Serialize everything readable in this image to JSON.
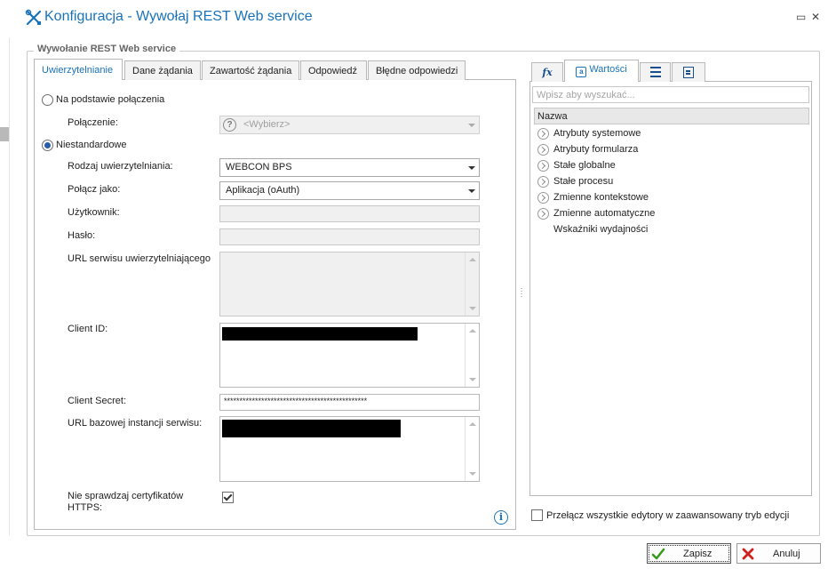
{
  "window": {
    "title": "Konfiguracja - Wywołaj REST Web service",
    "restore_glyph": "▭",
    "close_glyph": "✕",
    "icon": "tools-icon"
  },
  "group": {
    "legend": "Wywołanie REST Web service"
  },
  "tabs": [
    {
      "label": "Uwierzytelnianie",
      "active": true
    },
    {
      "label": "Dane żądania"
    },
    {
      "label": "Zawartość żądania"
    },
    {
      "label": "Odpowiedź"
    },
    {
      "label": "Błędne odpowiedzi"
    }
  ],
  "form": {
    "radio_connection": {
      "label": "Na podstawie połączenia",
      "checked": false
    },
    "connection": {
      "label": "Połączenie:",
      "value": "<Wybierz>",
      "icon": "question-icon"
    },
    "radio_custom": {
      "label": "Niestandardowe",
      "checked": true
    },
    "auth_type": {
      "label": "Rodzaj uwierzytelniania:",
      "value": "WEBCON BPS"
    },
    "connect_as": {
      "label": "Połącz jako:",
      "value": "Aplikacja (oAuth)"
    },
    "user": {
      "label": "Użytkownik:",
      "value": ""
    },
    "password": {
      "label": "Hasło:",
      "value": ""
    },
    "auth_url": {
      "label": "URL serwisu uwierzytelniającego",
      "value": ""
    },
    "client_id": {
      "label": "Client ID:"
    },
    "client_secret": {
      "label": "Client Secret:",
      "value": "**********************************************"
    },
    "base_url": {
      "label": "URL bazowej instancji serwisu:"
    },
    "skip_cert": {
      "label_line1": "Nie sprawdzaj certyfikatów",
      "label_line2": "HTTPS:",
      "checked": true
    },
    "info_glyph": "i"
  },
  "right": {
    "tabs": [
      {
        "icon": "function-icon",
        "label": "fx"
      },
      {
        "icon": "values-icon",
        "label": "Wartości",
        "active": true
      },
      {
        "icon": "list-icon"
      },
      {
        "icon": "form-icon"
      }
    ],
    "search_placeholder": "Wpisz aby wyszukać...",
    "column_header": "Nazwa",
    "tree": [
      {
        "label": "Atrybuty systemowe",
        "expandable": true
      },
      {
        "label": "Atrybuty formularza",
        "expandable": true
      },
      {
        "label": "Stałe globalne",
        "expandable": true
      },
      {
        "label": "Stałe procesu",
        "expandable": true
      },
      {
        "label": "Zmienne kontekstowe",
        "expandable": true
      },
      {
        "label": "Zmienne automatyczne",
        "expandable": true
      },
      {
        "label": "Wskaźniki wydajności",
        "expandable": false
      }
    ],
    "advanced_mode": {
      "label": "Przełącz wszystkie edytory w zaawansowany tryb edycji",
      "checked": false
    }
  },
  "buttons": {
    "save": {
      "label": "Zapisz",
      "icon": "checkmark-icon",
      "color": "#3a9a1e"
    },
    "cancel": {
      "label": "Anuluj",
      "icon": "close-icon",
      "color": "#d0201c"
    }
  }
}
